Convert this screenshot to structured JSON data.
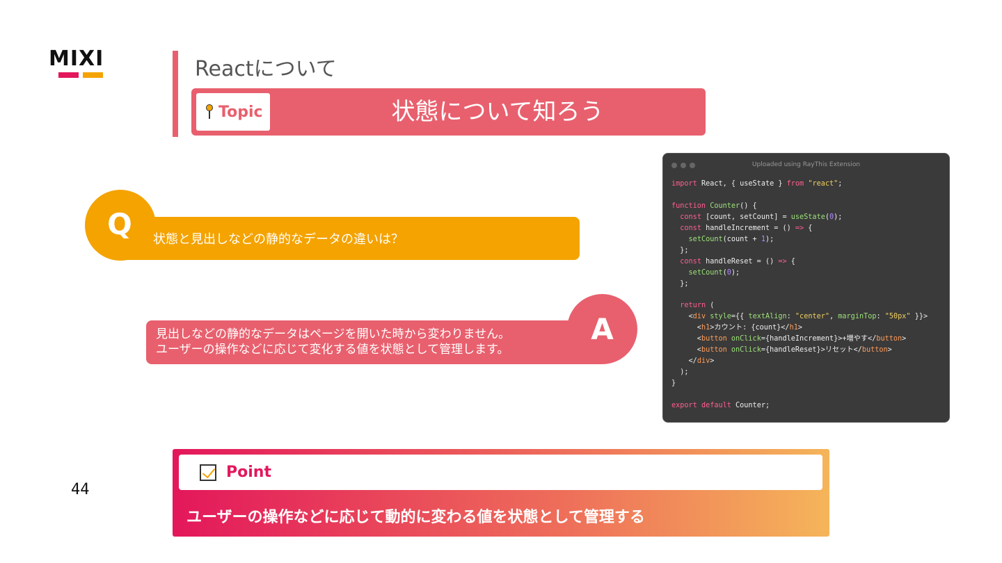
{
  "logo": {
    "text": "MIXI",
    "bar_colors": [
      "#e3175b",
      "#f4a300"
    ]
  },
  "header": {
    "title": "Reactについて"
  },
  "topic": {
    "tag_label": "Topic",
    "icon": "pin-icon",
    "title": "状態について知ろう"
  },
  "qa": {
    "q_letter": "Q",
    "question": "状態と見出しなどの静的なデータの違いは？",
    "a_letter": "A",
    "answer_line1": "見出しなどの静的なデータはページを開いた時から変わりません。",
    "answer_line2": "ユーザーの操作などに応じて変化する値を状態として管理します。"
  },
  "code_window": {
    "caption": "Uploaded using RayThis Extension",
    "lines": [
      "import React, { useState } from \"react\";",
      "",
      "function Counter() {",
      "  const [count, setCount] = useState(0);",
      "  const handleIncrement = () => {",
      "    setCount(count + 1);",
      "  };",
      "  const handleReset = () => {",
      "    setCount(0);",
      "  };",
      "",
      "  return (",
      "    <div style={{ textAlign: \"center\", marginTop: \"50px\" }}>",
      "      <h1>カウント: {count}</h1>",
      "      <button onClick={handleIncrement}>+増やす</button>",
      "      <button onClick={handleReset}>リセット</button>",
      "    </div>",
      "  );",
      "}",
      "",
      "export default Counter;"
    ]
  },
  "page_number": "44",
  "point": {
    "label": "Point",
    "icon": "checkbox-icon",
    "text": "ユーザーの操作などに応じて動的に変わる値を状態として管理する"
  },
  "colors": {
    "accent_pink": "#e8606e",
    "accent_orange": "#f4a300",
    "code_bg": "#3a3a3a"
  }
}
